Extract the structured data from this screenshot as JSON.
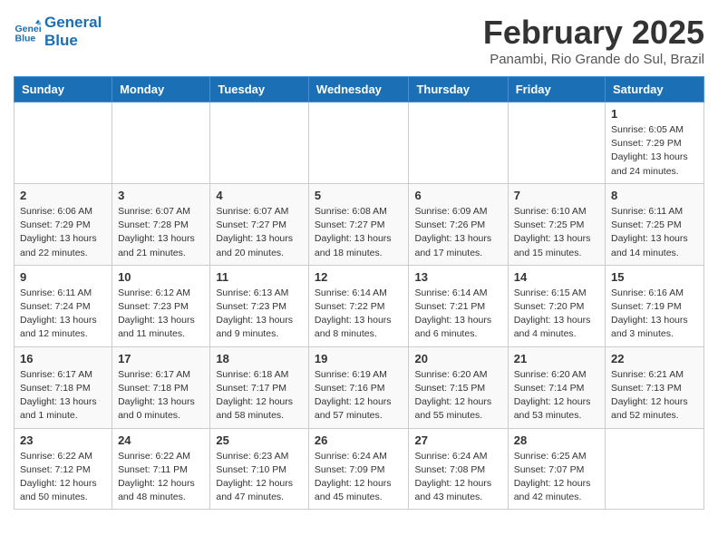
{
  "header": {
    "logo_line1": "General",
    "logo_line2": "Blue",
    "month_title": "February 2025",
    "location": "Panambi, Rio Grande do Sul, Brazil"
  },
  "days_of_week": [
    "Sunday",
    "Monday",
    "Tuesday",
    "Wednesday",
    "Thursday",
    "Friday",
    "Saturday"
  ],
  "weeks": [
    [
      {
        "day": "",
        "info": ""
      },
      {
        "day": "",
        "info": ""
      },
      {
        "day": "",
        "info": ""
      },
      {
        "day": "",
        "info": ""
      },
      {
        "day": "",
        "info": ""
      },
      {
        "day": "",
        "info": ""
      },
      {
        "day": "1",
        "info": "Sunrise: 6:05 AM\nSunset: 7:29 PM\nDaylight: 13 hours\nand 24 minutes."
      }
    ],
    [
      {
        "day": "2",
        "info": "Sunrise: 6:06 AM\nSunset: 7:29 PM\nDaylight: 13 hours\nand 22 minutes."
      },
      {
        "day": "3",
        "info": "Sunrise: 6:07 AM\nSunset: 7:28 PM\nDaylight: 13 hours\nand 21 minutes."
      },
      {
        "day": "4",
        "info": "Sunrise: 6:07 AM\nSunset: 7:27 PM\nDaylight: 13 hours\nand 20 minutes."
      },
      {
        "day": "5",
        "info": "Sunrise: 6:08 AM\nSunset: 7:27 PM\nDaylight: 13 hours\nand 18 minutes."
      },
      {
        "day": "6",
        "info": "Sunrise: 6:09 AM\nSunset: 7:26 PM\nDaylight: 13 hours\nand 17 minutes."
      },
      {
        "day": "7",
        "info": "Sunrise: 6:10 AM\nSunset: 7:25 PM\nDaylight: 13 hours\nand 15 minutes."
      },
      {
        "day": "8",
        "info": "Sunrise: 6:11 AM\nSunset: 7:25 PM\nDaylight: 13 hours\nand 14 minutes."
      }
    ],
    [
      {
        "day": "9",
        "info": "Sunrise: 6:11 AM\nSunset: 7:24 PM\nDaylight: 13 hours\nand 12 minutes."
      },
      {
        "day": "10",
        "info": "Sunrise: 6:12 AM\nSunset: 7:23 PM\nDaylight: 13 hours\nand 11 minutes."
      },
      {
        "day": "11",
        "info": "Sunrise: 6:13 AM\nSunset: 7:23 PM\nDaylight: 13 hours\nand 9 minutes."
      },
      {
        "day": "12",
        "info": "Sunrise: 6:14 AM\nSunset: 7:22 PM\nDaylight: 13 hours\nand 8 minutes."
      },
      {
        "day": "13",
        "info": "Sunrise: 6:14 AM\nSunset: 7:21 PM\nDaylight: 13 hours\nand 6 minutes."
      },
      {
        "day": "14",
        "info": "Sunrise: 6:15 AM\nSunset: 7:20 PM\nDaylight: 13 hours\nand 4 minutes."
      },
      {
        "day": "15",
        "info": "Sunrise: 6:16 AM\nSunset: 7:19 PM\nDaylight: 13 hours\nand 3 minutes."
      }
    ],
    [
      {
        "day": "16",
        "info": "Sunrise: 6:17 AM\nSunset: 7:18 PM\nDaylight: 13 hours\nand 1 minute."
      },
      {
        "day": "17",
        "info": "Sunrise: 6:17 AM\nSunset: 7:18 PM\nDaylight: 13 hours\nand 0 minutes."
      },
      {
        "day": "18",
        "info": "Sunrise: 6:18 AM\nSunset: 7:17 PM\nDaylight: 12 hours\nand 58 minutes."
      },
      {
        "day": "19",
        "info": "Sunrise: 6:19 AM\nSunset: 7:16 PM\nDaylight: 12 hours\nand 57 minutes."
      },
      {
        "day": "20",
        "info": "Sunrise: 6:20 AM\nSunset: 7:15 PM\nDaylight: 12 hours\nand 55 minutes."
      },
      {
        "day": "21",
        "info": "Sunrise: 6:20 AM\nSunset: 7:14 PM\nDaylight: 12 hours\nand 53 minutes."
      },
      {
        "day": "22",
        "info": "Sunrise: 6:21 AM\nSunset: 7:13 PM\nDaylight: 12 hours\nand 52 minutes."
      }
    ],
    [
      {
        "day": "23",
        "info": "Sunrise: 6:22 AM\nSunset: 7:12 PM\nDaylight: 12 hours\nand 50 minutes."
      },
      {
        "day": "24",
        "info": "Sunrise: 6:22 AM\nSunset: 7:11 PM\nDaylight: 12 hours\nand 48 minutes."
      },
      {
        "day": "25",
        "info": "Sunrise: 6:23 AM\nSunset: 7:10 PM\nDaylight: 12 hours\nand 47 minutes."
      },
      {
        "day": "26",
        "info": "Sunrise: 6:24 AM\nSunset: 7:09 PM\nDaylight: 12 hours\nand 45 minutes."
      },
      {
        "day": "27",
        "info": "Sunrise: 6:24 AM\nSunset: 7:08 PM\nDaylight: 12 hours\nand 43 minutes."
      },
      {
        "day": "28",
        "info": "Sunrise: 6:25 AM\nSunset: 7:07 PM\nDaylight: 12 hours\nand 42 minutes."
      },
      {
        "day": "",
        "info": ""
      }
    ]
  ]
}
